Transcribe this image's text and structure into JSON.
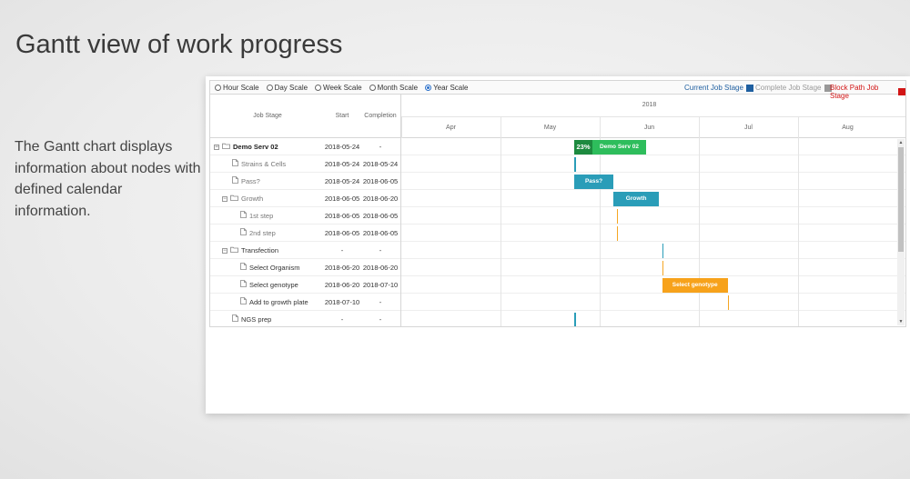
{
  "headline": "Gantt view of work progress",
  "description": "The Gantt chart displays information about nodes with defined calendar information.",
  "toolbar": {
    "scales": [
      {
        "label": "Hour Scale",
        "selected": false
      },
      {
        "label": "Day Scale",
        "selected": false
      },
      {
        "label": "Week Scale",
        "selected": false
      },
      {
        "label": "Month Scale",
        "selected": false
      },
      {
        "label": "Year Scale",
        "selected": true
      }
    ],
    "legend": [
      {
        "label": "Current Job Stage",
        "color": "#1f5fa0"
      },
      {
        "label": "Complete Job Stage",
        "color": "#999999"
      },
      {
        "label": "Block Path Job Stage",
        "color": "#d21515"
      }
    ]
  },
  "columns": {
    "job_stage": "Job Stage",
    "start": "Start",
    "completion": "Completion"
  },
  "timeline": {
    "year": "2018",
    "months": [
      "Apr",
      "May",
      "Jun",
      "Jul",
      "Aug"
    ]
  },
  "rows": [
    {
      "name": "Demo Serv 02",
      "start": "2018-05-24",
      "completion": "-",
      "level": 0,
      "type": "folder",
      "toggle": "−",
      "style": "bold"
    },
    {
      "name": "Strains & Cells",
      "start": "2018-05-24",
      "completion": "2018-05-24",
      "level": 1,
      "type": "file",
      "style": "grey"
    },
    {
      "name": "Pass?",
      "start": "2018-05-24",
      "completion": "2018-06-05",
      "level": 1,
      "type": "file",
      "style": "grey"
    },
    {
      "name": "Growth",
      "start": "2018-06-05",
      "completion": "2018-06-20",
      "level": 1,
      "type": "folder",
      "toggle": "−",
      "style": "grey"
    },
    {
      "name": "1st step",
      "start": "2018-06-05",
      "completion": "2018-06-05",
      "level": 2,
      "type": "file",
      "style": "grey"
    },
    {
      "name": "2nd step",
      "start": "2018-06-05",
      "completion": "2018-06-05",
      "level": 2,
      "type": "file",
      "style": "grey"
    },
    {
      "name": "Transfection",
      "start": "-",
      "completion": "-",
      "level": 1,
      "type": "folder",
      "toggle": "−",
      "style": "normal"
    },
    {
      "name": "Select Organism",
      "start": "2018-06-20",
      "completion": "2018-06-20",
      "level": 2,
      "type": "file",
      "style": "normal"
    },
    {
      "name": "Select genotype",
      "start": "2018-06-20",
      "completion": "2018-07-10",
      "level": 2,
      "type": "file",
      "style": "normal"
    },
    {
      "name": "Add to growth plate",
      "start": "2018-07-10",
      "completion": "-",
      "level": 2,
      "type": "file",
      "style": "normal"
    },
    {
      "name": "NGS prep",
      "start": "-",
      "completion": "-",
      "level": 1,
      "type": "file",
      "style": "normal"
    }
  ],
  "bars": [
    {
      "row": 0,
      "kind": "bar",
      "start": "2018-05-24",
      "end": "2018-06-15",
      "label": "Demo Serv 02",
      "percent": "23%",
      "percent_value": 23,
      "color": "#2ebd5c",
      "progress_color": "#1d8a3f"
    },
    {
      "row": 1,
      "kind": "tick",
      "start": "2018-05-24",
      "color": "#2a9db8"
    },
    {
      "row": 2,
      "kind": "bar",
      "start": "2018-05-24",
      "end": "2018-06-05",
      "label": "Pass?",
      "color": "#2a9db8"
    },
    {
      "row": 3,
      "kind": "bar",
      "start": "2018-06-05",
      "end": "2018-06-19",
      "label": "Growth",
      "color": "#2a9db8"
    },
    {
      "row": 4,
      "kind": "tick",
      "start": "2018-06-06",
      "color": "#f5a623"
    },
    {
      "row": 5,
      "kind": "tick",
      "start": "2018-06-06",
      "color": "#f5a623"
    },
    {
      "row": 6,
      "kind": "tick",
      "start": "2018-06-20",
      "color": "#2a9db8"
    },
    {
      "row": 7,
      "kind": "tick",
      "start": "2018-06-20",
      "color": "#f5a623"
    },
    {
      "row": 8,
      "kind": "bar",
      "start": "2018-06-20",
      "end": "2018-07-10",
      "label": "Select genotype",
      "color": "#f7a21b"
    },
    {
      "row": 9,
      "kind": "tick",
      "start": "2018-07-10",
      "color": "#f5a623"
    },
    {
      "row": 10,
      "kind": "tick",
      "start": "2018-05-24",
      "color": "#2a9db8"
    }
  ]
}
